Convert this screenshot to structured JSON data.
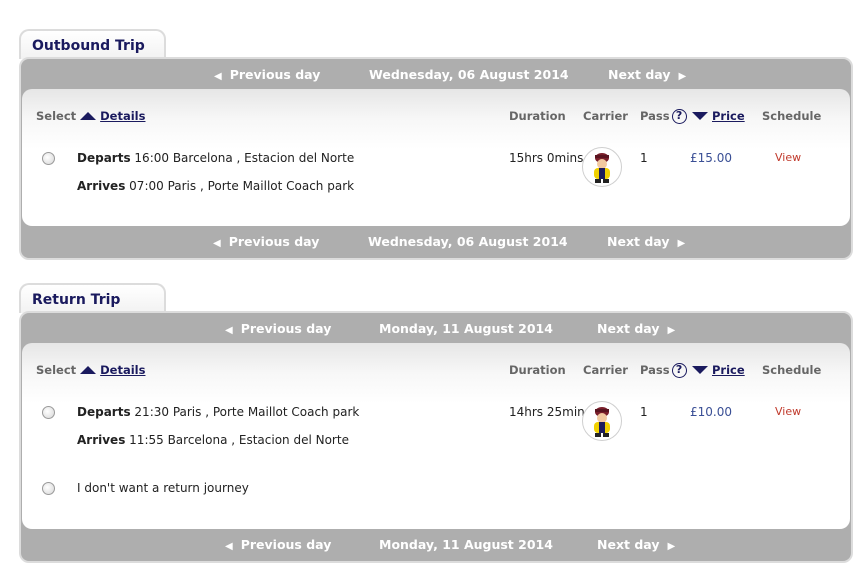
{
  "outbound": {
    "tab_label": "Outbound Trip",
    "nav": {
      "prev": "Previous day",
      "date": "Wednesday, 06 August 2014",
      "next": "Next day"
    },
    "headers": {
      "select": "Select",
      "details": "Details",
      "duration": "Duration",
      "carrier": "Carrier",
      "pass": "Pass",
      "help": "?",
      "price": "Price",
      "schedule": "Schedule"
    },
    "row": {
      "departs_label": "Departs",
      "departs_value": "16:00 Barcelona , Estacion del Norte",
      "arrives_label": "Arrives",
      "arrives_value": "07:00 Paris , Porte Maillot Coach park",
      "duration": "15hrs 0mins",
      "pass": "1",
      "price": "£15.00",
      "schedule": "View"
    }
  },
  "return": {
    "tab_label": "Return Trip",
    "nav": {
      "prev": "Previous day",
      "date": "Monday, 11 August 2014",
      "next": "Next day"
    },
    "headers": {
      "select": "Select",
      "details": "Details",
      "duration": "Duration",
      "carrier": "Carrier",
      "pass": "Pass",
      "help": "?",
      "price": "Price",
      "schedule": "Schedule"
    },
    "row": {
      "departs_label": "Departs",
      "departs_value": "21:30 Paris , Porte Maillot Coach park",
      "arrives_label": "Arrives",
      "arrives_value": "11:55 Barcelona , Estacion del Norte",
      "duration": "14hrs 25mins",
      "pass": "1",
      "price": "£10.00",
      "schedule": "View"
    },
    "no_return_label": "I don't want a return journey"
  },
  "icons": {
    "nav_prev": "left-arrow-icon",
    "nav_next": "right-arrow-icon",
    "sort_up": "sort-up-icon",
    "sort_down": "sort-down-icon",
    "help": "help-icon",
    "carrier": "carrier-mascot-icon"
  },
  "colors": {
    "accent": "#1a1a5e",
    "nav_bar": "#aeaeae",
    "price": "#3a4f95",
    "view_link": "#c0392b"
  }
}
